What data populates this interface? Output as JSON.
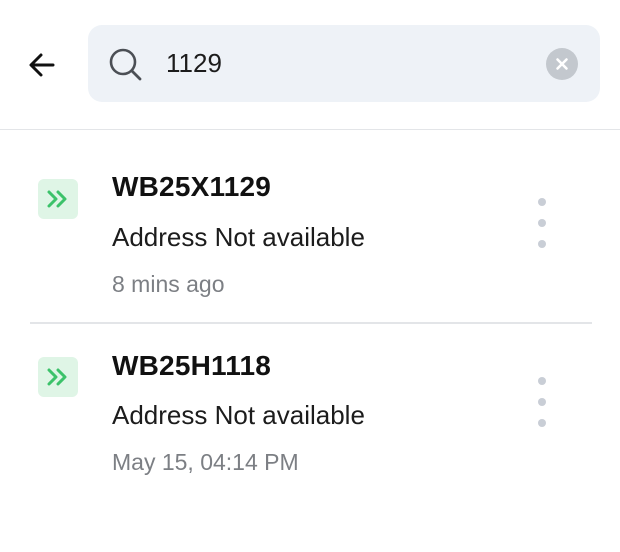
{
  "search": {
    "value": "1129"
  },
  "results": [
    {
      "plate": "WB25X1129",
      "address": "Address Not available",
      "time": "8 mins ago"
    },
    {
      "plate": "WB25H1118",
      "address": "Address Not available",
      "time": "May 15, 04:14 PM"
    }
  ],
  "colors": {
    "badge_bg": "#dff5e6",
    "badge_icon": "#3cc26a",
    "search_bg": "#eef2f7"
  },
  "icons": {
    "back": "arrow-left-icon",
    "search": "search-icon",
    "clear": "close-circle-icon",
    "badge": "double-chevron-right-icon",
    "more": "more-vertical-icon"
  }
}
